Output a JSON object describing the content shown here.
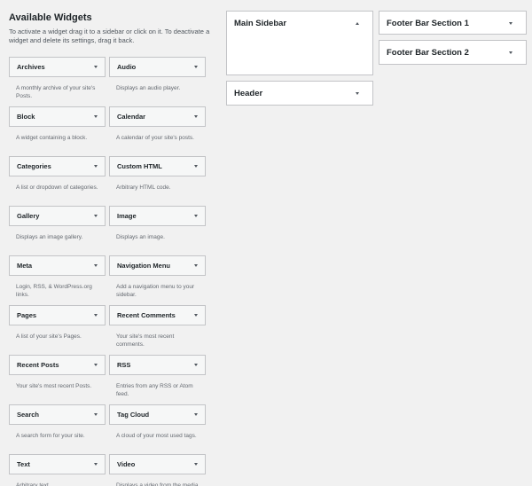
{
  "available": {
    "title": "Available Widgets",
    "description": "To activate a widget drag it to a sidebar or click on it. To deactivate a widget and delete its settings, drag it back."
  },
  "widgets": [
    {
      "title": "Archives",
      "description": "A monthly archive of your site's Posts."
    },
    {
      "title": "Audio",
      "description": "Displays an audio player."
    },
    {
      "title": "Block",
      "description": "A widget containing a block."
    },
    {
      "title": "Calendar",
      "description": "A calendar of your site's posts."
    },
    {
      "title": "Categories",
      "description": "A list or dropdown of categories."
    },
    {
      "title": "Custom HTML",
      "description": "Arbitrary HTML code."
    },
    {
      "title": "Gallery",
      "description": "Displays an image gallery."
    },
    {
      "title": "Image",
      "description": "Displays an image."
    },
    {
      "title": "Meta",
      "description": "Login, RSS, & WordPress.org links."
    },
    {
      "title": "Navigation Menu",
      "description": "Add a navigation menu to your sidebar."
    },
    {
      "title": "Pages",
      "description": "A list of your site's Pages."
    },
    {
      "title": "Recent Comments",
      "description": "Your site's most recent comments."
    },
    {
      "title": "Recent Posts",
      "description": "Your site's most recent Posts."
    },
    {
      "title": "RSS",
      "description": "Entries from any RSS or Atom feed."
    },
    {
      "title": "Search",
      "description": "A search form for your site."
    },
    {
      "title": "Tag Cloud",
      "description": "A cloud of your most used tags."
    },
    {
      "title": "Text",
      "description": "Arbitrary text."
    },
    {
      "title": "Video",
      "description": "Displays a video from the media library or from YouTube, Vimeo, or another provider."
    }
  ],
  "sidebars": {
    "main": {
      "title": "Main Sidebar"
    },
    "header": {
      "title": "Header"
    },
    "footer1": {
      "title": "Footer Bar Section 1"
    },
    "footer2": {
      "title": "Footer Bar Section 2"
    }
  },
  "icons": {
    "collapse": "arrow-up-icon",
    "expand": "arrow-down-icon"
  },
  "colors": {
    "background": "#f1f1f1",
    "widget_bg": "#f6f7f7",
    "border": "#c3c4c7",
    "text": "#1d2327",
    "muted": "#646970"
  }
}
